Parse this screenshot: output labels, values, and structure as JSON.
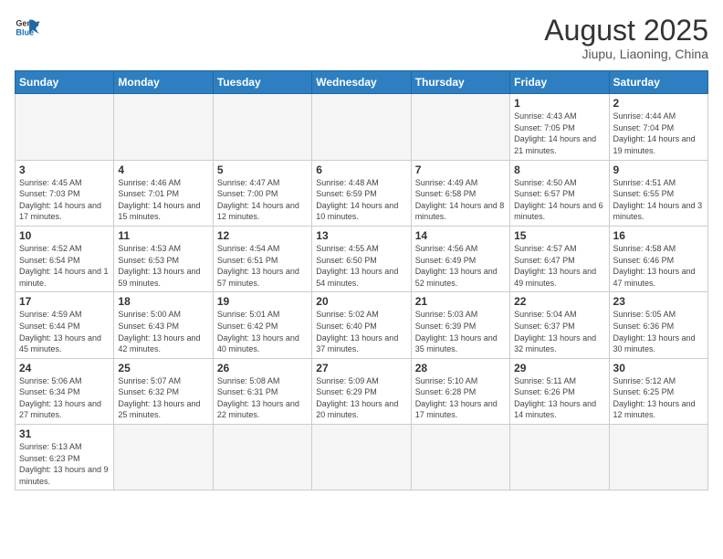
{
  "header": {
    "logo_general": "General",
    "logo_blue": "Blue",
    "month_year": "August 2025",
    "location": "Jiupu, Liaoning, China"
  },
  "days_of_week": [
    "Sunday",
    "Monday",
    "Tuesday",
    "Wednesday",
    "Thursday",
    "Friday",
    "Saturday"
  ],
  "weeks": [
    [
      {
        "day": "",
        "info": ""
      },
      {
        "day": "",
        "info": ""
      },
      {
        "day": "",
        "info": ""
      },
      {
        "day": "",
        "info": ""
      },
      {
        "day": "",
        "info": ""
      },
      {
        "day": "1",
        "info": "Sunrise: 4:43 AM\nSunset: 7:05 PM\nDaylight: 14 hours and 21 minutes."
      },
      {
        "day": "2",
        "info": "Sunrise: 4:44 AM\nSunset: 7:04 PM\nDaylight: 14 hours and 19 minutes."
      }
    ],
    [
      {
        "day": "3",
        "info": "Sunrise: 4:45 AM\nSunset: 7:03 PM\nDaylight: 14 hours and 17 minutes."
      },
      {
        "day": "4",
        "info": "Sunrise: 4:46 AM\nSunset: 7:01 PM\nDaylight: 14 hours and 15 minutes."
      },
      {
        "day": "5",
        "info": "Sunrise: 4:47 AM\nSunset: 7:00 PM\nDaylight: 14 hours and 12 minutes."
      },
      {
        "day": "6",
        "info": "Sunrise: 4:48 AM\nSunset: 6:59 PM\nDaylight: 14 hours and 10 minutes."
      },
      {
        "day": "7",
        "info": "Sunrise: 4:49 AM\nSunset: 6:58 PM\nDaylight: 14 hours and 8 minutes."
      },
      {
        "day": "8",
        "info": "Sunrise: 4:50 AM\nSunset: 6:57 PM\nDaylight: 14 hours and 6 minutes."
      },
      {
        "day": "9",
        "info": "Sunrise: 4:51 AM\nSunset: 6:55 PM\nDaylight: 14 hours and 3 minutes."
      }
    ],
    [
      {
        "day": "10",
        "info": "Sunrise: 4:52 AM\nSunset: 6:54 PM\nDaylight: 14 hours and 1 minute."
      },
      {
        "day": "11",
        "info": "Sunrise: 4:53 AM\nSunset: 6:53 PM\nDaylight: 13 hours and 59 minutes."
      },
      {
        "day": "12",
        "info": "Sunrise: 4:54 AM\nSunset: 6:51 PM\nDaylight: 13 hours and 57 minutes."
      },
      {
        "day": "13",
        "info": "Sunrise: 4:55 AM\nSunset: 6:50 PM\nDaylight: 13 hours and 54 minutes."
      },
      {
        "day": "14",
        "info": "Sunrise: 4:56 AM\nSunset: 6:49 PM\nDaylight: 13 hours and 52 minutes."
      },
      {
        "day": "15",
        "info": "Sunrise: 4:57 AM\nSunset: 6:47 PM\nDaylight: 13 hours and 49 minutes."
      },
      {
        "day": "16",
        "info": "Sunrise: 4:58 AM\nSunset: 6:46 PM\nDaylight: 13 hours and 47 minutes."
      }
    ],
    [
      {
        "day": "17",
        "info": "Sunrise: 4:59 AM\nSunset: 6:44 PM\nDaylight: 13 hours and 45 minutes."
      },
      {
        "day": "18",
        "info": "Sunrise: 5:00 AM\nSunset: 6:43 PM\nDaylight: 13 hours and 42 minutes."
      },
      {
        "day": "19",
        "info": "Sunrise: 5:01 AM\nSunset: 6:42 PM\nDaylight: 13 hours and 40 minutes."
      },
      {
        "day": "20",
        "info": "Sunrise: 5:02 AM\nSunset: 6:40 PM\nDaylight: 13 hours and 37 minutes."
      },
      {
        "day": "21",
        "info": "Sunrise: 5:03 AM\nSunset: 6:39 PM\nDaylight: 13 hours and 35 minutes."
      },
      {
        "day": "22",
        "info": "Sunrise: 5:04 AM\nSunset: 6:37 PM\nDaylight: 13 hours and 32 minutes."
      },
      {
        "day": "23",
        "info": "Sunrise: 5:05 AM\nSunset: 6:36 PM\nDaylight: 13 hours and 30 minutes."
      }
    ],
    [
      {
        "day": "24",
        "info": "Sunrise: 5:06 AM\nSunset: 6:34 PM\nDaylight: 13 hours and 27 minutes."
      },
      {
        "day": "25",
        "info": "Sunrise: 5:07 AM\nSunset: 6:32 PM\nDaylight: 13 hours and 25 minutes."
      },
      {
        "day": "26",
        "info": "Sunrise: 5:08 AM\nSunset: 6:31 PM\nDaylight: 13 hours and 22 minutes."
      },
      {
        "day": "27",
        "info": "Sunrise: 5:09 AM\nSunset: 6:29 PM\nDaylight: 13 hours and 20 minutes."
      },
      {
        "day": "28",
        "info": "Sunrise: 5:10 AM\nSunset: 6:28 PM\nDaylight: 13 hours and 17 minutes."
      },
      {
        "day": "29",
        "info": "Sunrise: 5:11 AM\nSunset: 6:26 PM\nDaylight: 13 hours and 14 minutes."
      },
      {
        "day": "30",
        "info": "Sunrise: 5:12 AM\nSunset: 6:25 PM\nDaylight: 13 hours and 12 minutes."
      }
    ],
    [
      {
        "day": "31",
        "info": "Sunrise: 5:13 AM\nSunset: 6:23 PM\nDaylight: 13 hours and 9 minutes."
      },
      {
        "day": "",
        "info": ""
      },
      {
        "day": "",
        "info": ""
      },
      {
        "day": "",
        "info": ""
      },
      {
        "day": "",
        "info": ""
      },
      {
        "day": "",
        "info": ""
      },
      {
        "day": "",
        "info": ""
      }
    ]
  ]
}
